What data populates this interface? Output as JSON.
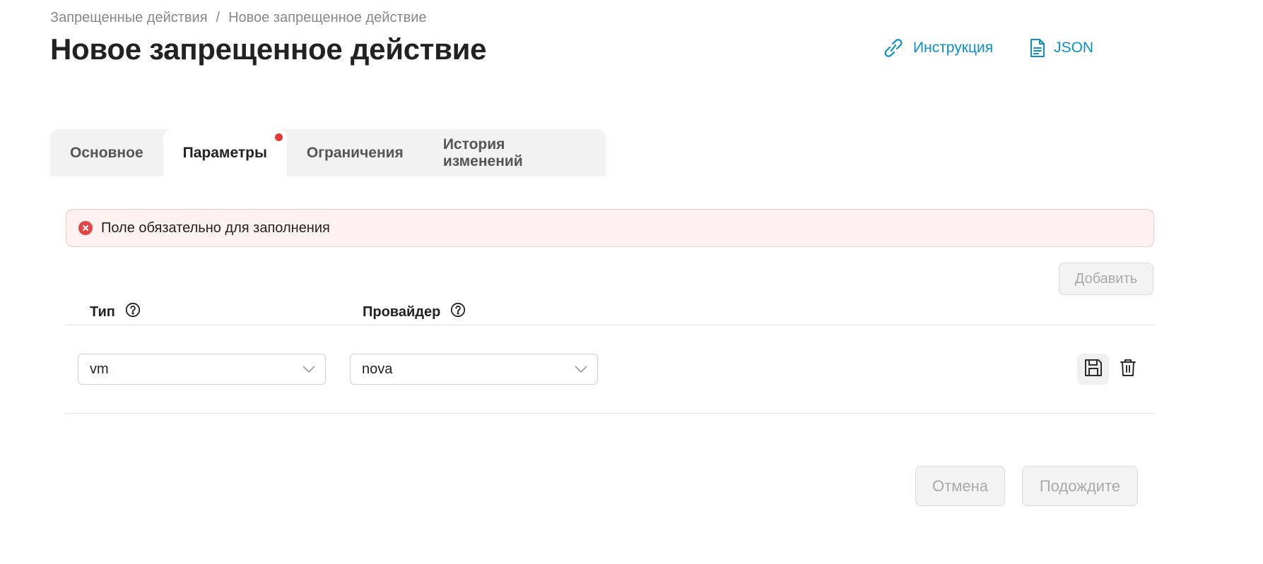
{
  "breadcrumb": {
    "items": [
      "Запрещенные действия",
      "Новое запрещенное действие"
    ],
    "separator": "/"
  },
  "page_title": "Новое запрещенное действие",
  "header_links": {
    "instruction": {
      "label": "Инструкция",
      "icon": "link-icon"
    },
    "json": {
      "label": "JSON",
      "icon": "document-icon"
    }
  },
  "tabs": [
    {
      "label": "Основное",
      "active": false
    },
    {
      "label": "Параметры",
      "active": true,
      "has_error_dot": true
    },
    {
      "label": "Ограничения",
      "active": false
    },
    {
      "label": "История изменений",
      "active": false
    }
  ],
  "alert": {
    "text": "Поле обязательно для заполнения",
    "icon": "error-icon"
  },
  "add_button": {
    "label": "Добавить",
    "disabled": true
  },
  "table": {
    "columns": [
      {
        "label": "Тип",
        "help_icon": "help-icon"
      },
      {
        "label": "Провайдер",
        "help_icon": "help-icon"
      }
    ],
    "rows": [
      {
        "type": "vm",
        "provider": "nova"
      }
    ]
  },
  "footer": {
    "cancel_label": "Отмена",
    "submit_label": "Подождите"
  },
  "colors": {
    "accent": "#0a8fc7",
    "error": "#e53935",
    "alert_bg": "#fff2f1",
    "disabled_text": "#a9a9a9"
  }
}
